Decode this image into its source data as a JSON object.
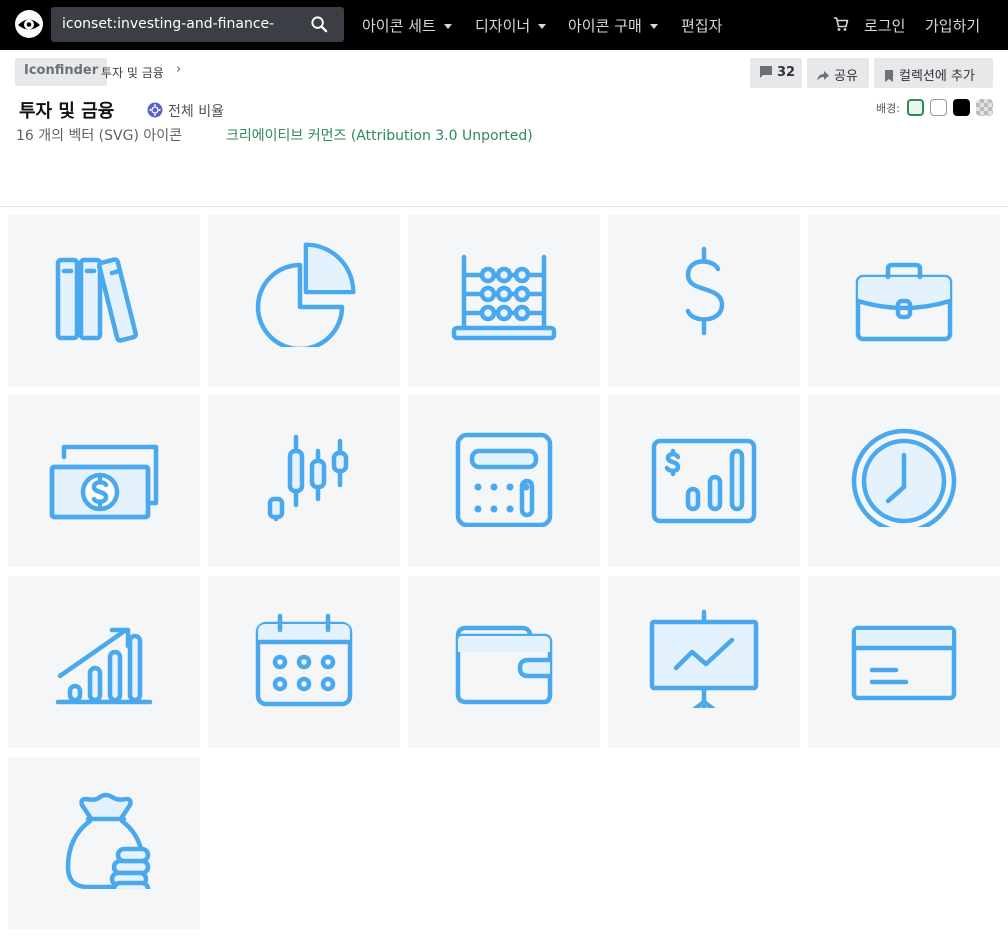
{
  "header": {
    "search_value": "iconset:investing-and-finance-",
    "nav": {
      "icon_sets": "아이콘 세트",
      "designers": "디자이너",
      "buy_icons": "아이콘 구매",
      "editor": "편집자",
      "login": "로그인",
      "signup": "가입하기"
    }
  },
  "breadcrumb": {
    "home": "Iconfinder",
    "current": "투자 및 금융"
  },
  "actions": {
    "comments_count": "32",
    "share": "공유",
    "add_collection": "컬렉션에 추가"
  },
  "iconset": {
    "title": "투자 및 금융",
    "ratio": "전체 비율",
    "count": "16 개의 벡터 (SVG) 아이콘",
    "license": "크리에이티브 커먼즈 (Attribution 3.0 Unported)",
    "background_label": "배경:"
  },
  "colors": {
    "accent": "#4aa8ee",
    "icon_fill": "#e4f2fd",
    "tile_bg": "#f5f6f7",
    "license": "#2e8b57",
    "topbar": "#000000"
  },
  "backgrounds": [
    "transparent",
    "white",
    "black",
    "checkered"
  ],
  "icons": [
    "books-icon",
    "pie-chart-icon",
    "abacus-icon",
    "dollar-icon",
    "briefcase-icon",
    "money-bills-icon",
    "candlestick-icon",
    "calculator-icon",
    "money-chart-icon",
    "clock-icon",
    "growth-chart-icon",
    "calendar-icon",
    "wallet-icon",
    "presentation-icon",
    "credit-card-icon",
    "money-bag-icon"
  ]
}
